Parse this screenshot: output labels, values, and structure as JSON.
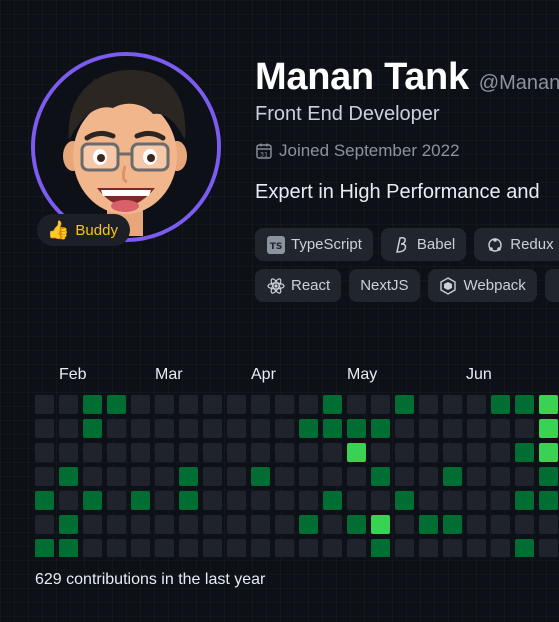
{
  "profile": {
    "name": "Manan Tank",
    "handle": "@Manan",
    "role": "Front End Developer",
    "joined": "Joined September 2022",
    "bio": "Expert in High Performance and",
    "badge": "Buddy",
    "ring_color": "#7c5cf0"
  },
  "skills": {
    "row1": [
      {
        "label": "TypeScript",
        "icon": "typescript-icon"
      },
      {
        "label": "Babel",
        "icon": "babel-icon"
      },
      {
        "label": "Redux",
        "icon": "redux-icon"
      }
    ],
    "row2": [
      {
        "label": "React",
        "icon": "react-icon"
      },
      {
        "label": "NextJS",
        "icon": "nextjs-icon"
      },
      {
        "label": "Webpack",
        "icon": "webpack-icon"
      }
    ]
  },
  "contributions": {
    "months": [
      "Feb",
      "Mar",
      "Apr",
      "May",
      "Jun"
    ],
    "summary": "629 contributions in the last year",
    "levels_colors": [
      "#1f232b",
      "#0e4429",
      "#006d32",
      "#26a641",
      "#39d353"
    ],
    "weeks": [
      [
        0,
        0,
        0,
        0,
        2,
        0,
        2
      ],
      [
        0,
        0,
        0,
        2,
        0,
        2,
        2
      ],
      [
        2,
        2,
        0,
        0,
        2,
        0,
        0
      ],
      [
        2,
        0,
        0,
        0,
        0,
        0,
        0
      ],
      [
        0,
        0,
        0,
        0,
        2,
        0,
        0
      ],
      [
        0,
        0,
        0,
        0,
        0,
        0,
        0
      ],
      [
        0,
        0,
        0,
        2,
        2,
        0,
        0
      ],
      [
        0,
        0,
        0,
        0,
        0,
        0,
        0
      ],
      [
        0,
        0,
        0,
        0,
        0,
        0,
        0
      ],
      [
        0,
        0,
        0,
        2,
        0,
        0,
        0
      ],
      [
        0,
        0,
        0,
        0,
        0,
        0,
        0
      ],
      [
        0,
        2,
        0,
        0,
        0,
        2,
        0
      ],
      [
        2,
        2,
        0,
        0,
        2,
        0,
        0
      ],
      [
        0,
        2,
        4,
        0,
        0,
        2,
        0
      ],
      [
        0,
        2,
        0,
        2,
        0,
        4,
        2
      ],
      [
        2,
        0,
        0,
        0,
        2,
        0,
        0
      ],
      [
        0,
        0,
        0,
        0,
        0,
        2,
        0
      ],
      [
        0,
        0,
        0,
        2,
        0,
        2,
        0
      ],
      [
        0,
        0,
        0,
        0,
        0,
        0,
        0
      ],
      [
        2,
        0,
        0,
        0,
        0,
        0,
        0
      ],
      [
        2,
        0,
        2,
        0,
        2,
        0,
        2
      ],
      [
        4,
        4,
        4,
        2,
        2,
        0,
        0
      ],
      [
        0,
        0,
        0,
        0,
        0,
        0,
        0
      ]
    ]
  }
}
